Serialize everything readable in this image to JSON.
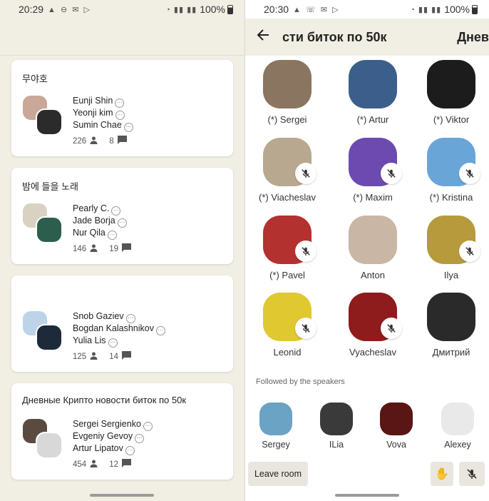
{
  "left": {
    "status": {
      "time": "20:29",
      "battery": "100%"
    },
    "rooms": [
      {
        "title": "무야호",
        "speakers": [
          "Eunji Shin",
          "Yeonji kim",
          "Sumin Chae"
        ],
        "listeners": "226",
        "messages": "8"
      },
      {
        "title": "밤에 들을 노래",
        "speakers": [
          "Pearly C.",
          "Jade Borja",
          "Nur Qila"
        ],
        "listeners": "146",
        "messages": "19"
      },
      {
        "title": "",
        "speakers": [
          "Snob Gaziev",
          "Bogdan Kalashnikov",
          "Yulia Lis"
        ],
        "listeners": "125",
        "messages": "14"
      },
      {
        "title": "Дневные Крипто новости биток по 50к",
        "speakers": [
          "Sergei Sergienko",
          "Evgeniy Gevoy",
          "Artur Lipatov"
        ],
        "listeners": "454",
        "messages": "12"
      }
    ]
  },
  "right": {
    "status": {
      "time": "20:30",
      "battery": "100%"
    },
    "title": "сти биток по 50к",
    "title_overflow": "Днев",
    "speakers": [
      {
        "name": "(*) Sergei",
        "muted": false,
        "color": "#8a7560"
      },
      {
        "name": "(*) Artur",
        "muted": false,
        "color": "#3b5f8a"
      },
      {
        "name": "(*) Viktor",
        "muted": false,
        "color": "#1c1c1c"
      },
      {
        "name": "(*) Viacheslav",
        "muted": true,
        "color": "#b9a890"
      },
      {
        "name": "(*) Maxim",
        "muted": true,
        "color": "#6c4ab0"
      },
      {
        "name": "(*) Kristina",
        "muted": true,
        "color": "#6aa5d8"
      },
      {
        "name": "(*) Pavel",
        "muted": true,
        "color": "#b3312e"
      },
      {
        "name": "Anton",
        "muted": false,
        "color": "#c9b6a5"
      },
      {
        "name": "Ilya",
        "muted": true,
        "color": "#b79a3c"
      },
      {
        "name": "Leonid",
        "muted": true,
        "color": "#e0c830"
      },
      {
        "name": "Vyacheslav",
        "muted": true,
        "color": "#8e1c1c"
      },
      {
        "name": "Дмитрий",
        "muted": false,
        "color": "#2a2a2a"
      }
    ],
    "followed_label": "Followed by the speakers",
    "followers": [
      {
        "name": "Sergey",
        "color": "#6ba3c4"
      },
      {
        "name": "ILia",
        "color": "#3a3a3a"
      },
      {
        "name": "Vova",
        "color": "#5a1515"
      },
      {
        "name": "Alexey",
        "color": "#e9e9e9"
      }
    ],
    "leave_label": "Leave room",
    "hand_icon": "✋"
  }
}
